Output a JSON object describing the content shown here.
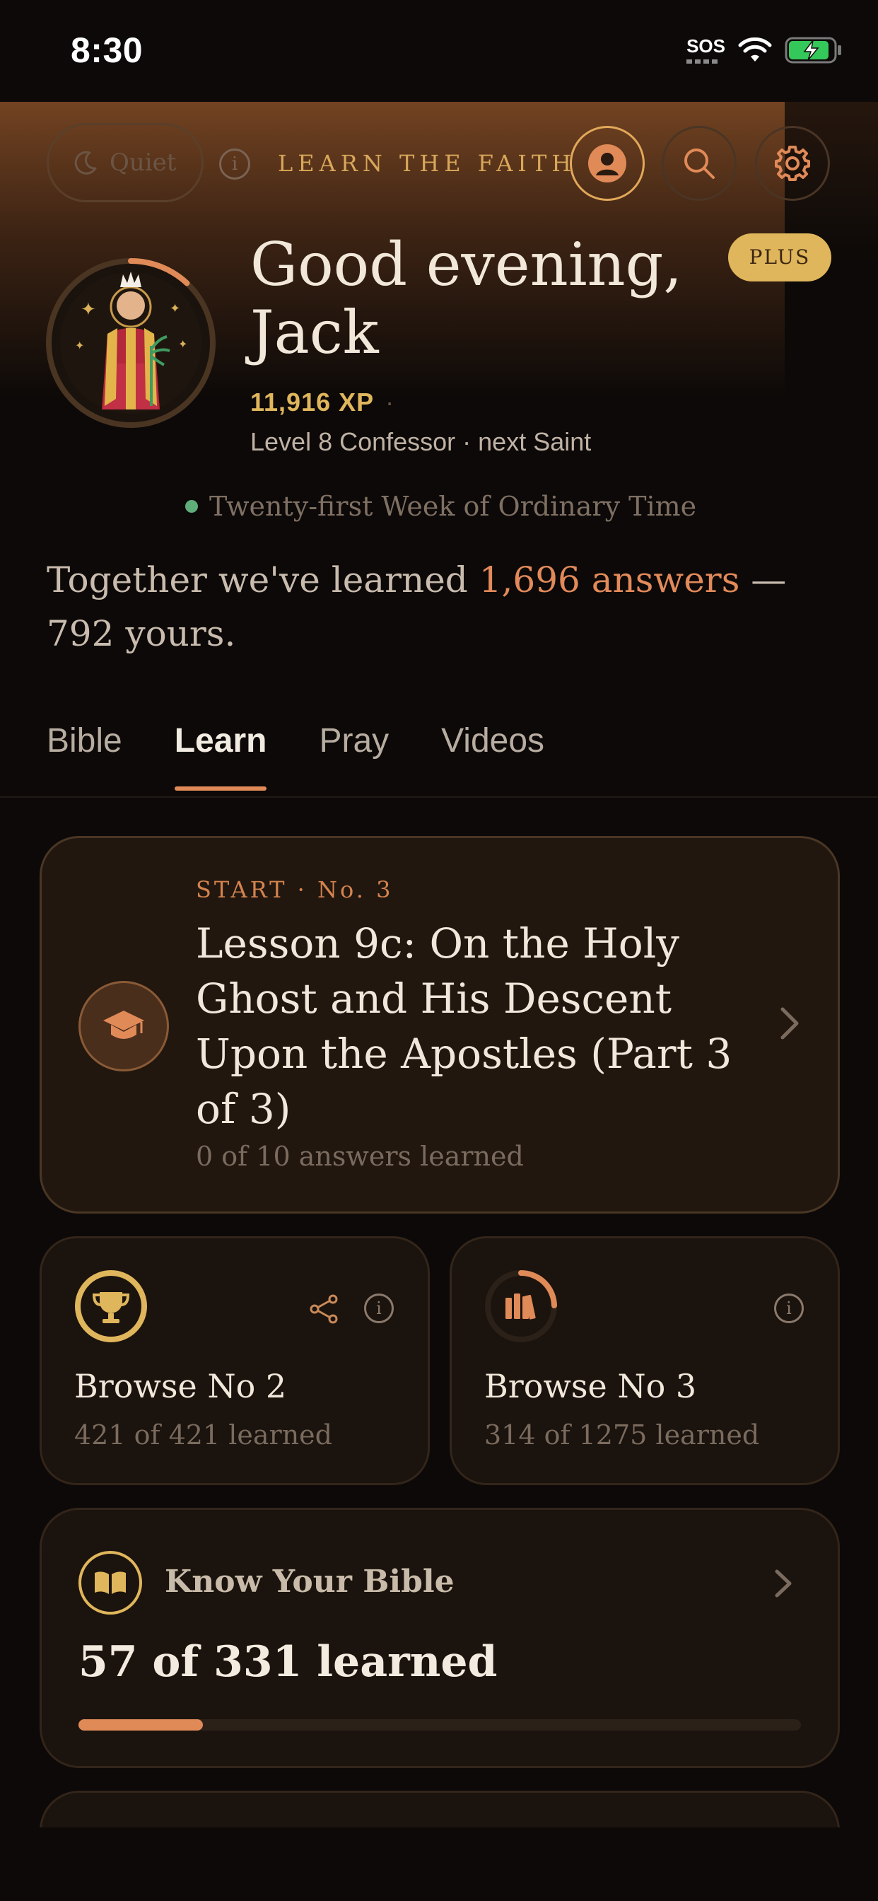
{
  "status_bar": {
    "time": "8:30",
    "sos": "SOS"
  },
  "header": {
    "quiet_label": "Quiet",
    "info_glyph": "i",
    "app_title": "LEARN THE FAITH",
    "buttons": [
      "profile-icon",
      "search-icon",
      "gear-icon"
    ]
  },
  "profile": {
    "greeting_line1": "Good evening,",
    "greeting_line2": "Jack",
    "plan_badge": "PLUS",
    "xp": "11,916 XP",
    "xp_separator": "·",
    "level": "Level 8 Confessor · next Saint",
    "level_progress": 0.12
  },
  "season": "Twenty-first Week of Ordinary Time",
  "together": {
    "prefix": "Together we've learned ",
    "highlight": "1,696 answers",
    "suffix": " — 792 yours."
  },
  "tabs": [
    {
      "label": "Bible",
      "active": false
    },
    {
      "label": "Learn",
      "active": true
    },
    {
      "label": "Pray",
      "active": false
    },
    {
      "label": "Videos",
      "active": false
    }
  ],
  "lesson": {
    "eyebrow": "START · No. 3",
    "title": "Lesson 9c: On the Holy Ghost and His Descent Upon the Apostles (Part 3 of 3)",
    "progress": "0 of 10 answers learned"
  },
  "browse": [
    {
      "title": "Browse No 2",
      "count": "421 of 421 learned",
      "progress": 1.0,
      "icon": "trophy-icon"
    },
    {
      "title": "Browse No 3",
      "count": "314 of 1275 learned",
      "progress": 0.246,
      "icon": "books-icon"
    }
  ],
  "bible": {
    "title": "Know Your Bible",
    "count": "57 of 331 learned",
    "progress": 0.172
  },
  "colors": {
    "accent": "#e08a58",
    "gold": "#e0b65c",
    "background": "#0c0908",
    "card": "#1b130d",
    "season_dot": "#5fae7a"
  }
}
